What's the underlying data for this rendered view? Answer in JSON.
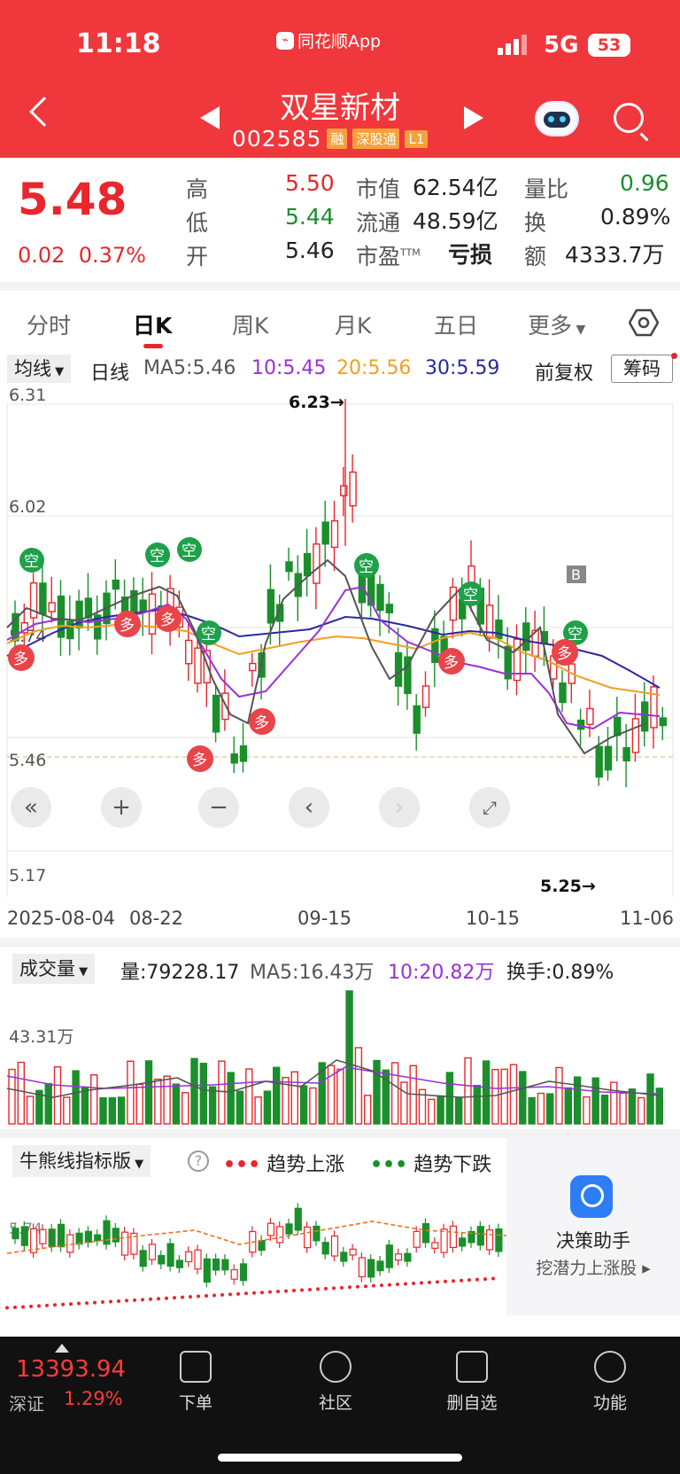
{
  "status": {
    "time": "11:18",
    "app": "同花顺App",
    "network": "5G",
    "battery": "53"
  },
  "stock": {
    "name": "双星新材",
    "code": "002585",
    "tags": [
      "融",
      "深股通",
      "L1"
    ]
  },
  "quote": {
    "price": "5.48",
    "change": "0.02",
    "change_pct": "0.37%",
    "high_l": "高",
    "high": "5.50",
    "low_l": "低",
    "low": "5.44",
    "open_l": "开",
    "open": "5.46",
    "mcap_l": "市值",
    "mcap": "62.54亿",
    "float_l": "流通",
    "float": "48.59亿",
    "pe_l": "市盈",
    "pe_sup": "TTM",
    "pe": "亏损",
    "vr_l": "量比",
    "vr": "0.96",
    "turn_l": "换",
    "turn": "0.89%",
    "amt_l": "额",
    "amt": "4333.7万"
  },
  "tabs": [
    "分时",
    "日K",
    "周K",
    "月K",
    "五日",
    "更多"
  ],
  "ma": {
    "btn": "均线",
    "period": "日线",
    "ma5": "MA5:5.46",
    "ma10": "10:5.45",
    "ma20": "20:5.56",
    "ma30": "30:5.59",
    "adj": "前复权",
    "chips": "筹码"
  },
  "chart_labels": {
    "y": [
      "6.31",
      "6.02",
      "5.74",
      "5.46",
      "5.17"
    ],
    "hi": "6.23→",
    "lo": "5.25→",
    "dates": [
      "2025-08-04",
      "08-22",
      "09-15",
      "10-15",
      "11-06"
    ]
  },
  "signals": {
    "empty": "空",
    "many": "多",
    "b": "B"
  },
  "volume": {
    "btn": "成交量",
    "vol": "量:79228.17",
    "ma5": "MA5:16.43万",
    "ma10": "10:20.82万",
    "turn": "换手:0.89%",
    "level": "43.31万"
  },
  "bull": {
    "btn": "牛熊线指标版",
    "q": "?",
    "up": "趋势上涨",
    "down": "趋势下跌",
    "level": "5.74",
    "helper_title": "决策助手",
    "helper_sub": "挖潜力上涨股 ▸"
  },
  "bottom": {
    "index": "13393.94",
    "index_name": "深证",
    "index_pct": "1.29%",
    "nav": [
      "下单",
      "社区",
      "删自选",
      "功能"
    ]
  },
  "colors": {
    "red": "#e8262c",
    "green": "#1a8f2b",
    "ma5": "#555555",
    "ma10": "#9b30d9",
    "ma20": "#f0a020",
    "ma30": "#2a2a9c"
  }
}
